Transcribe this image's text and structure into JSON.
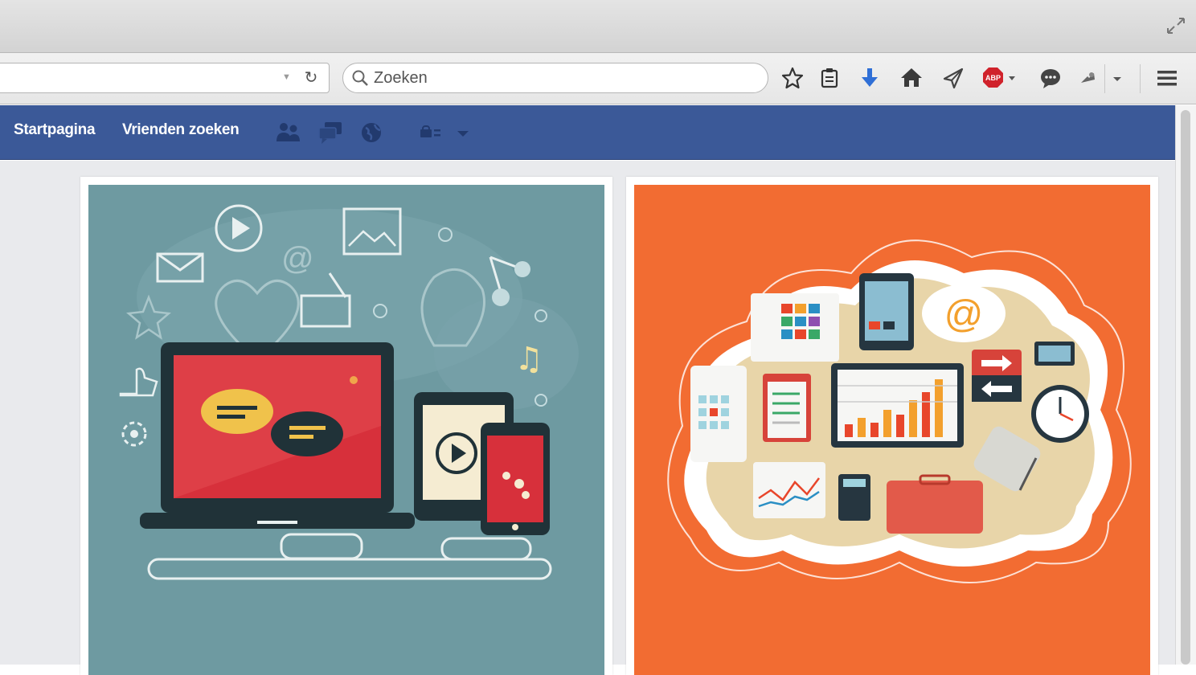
{
  "browser": {
    "search": {
      "placeholder": "Zoeken"
    },
    "toolbar_icons": [
      "star-icon",
      "clipboard-icon",
      "download-arrow-icon",
      "home-icon",
      "send-icon",
      "adblock-plus-icon",
      "chat-bubble-icon",
      "addon-icon",
      "menu-icon"
    ],
    "adblock_label": "ABP"
  },
  "facebook": {
    "brand_color": "#3b5998",
    "nav": {
      "home": "Startpagina",
      "find_friends": "Vrienden zoeken"
    },
    "icons": [
      "friend-requests-icon",
      "messages-icon",
      "notifications-globe-icon",
      "privacy-shortcuts-icon",
      "account-dropdown-icon"
    ]
  },
  "cards": [
    {
      "name": "devices-illustration",
      "background": "#6e9aa1"
    },
    {
      "name": "cloud-office-illustration",
      "background": "#f26c32"
    }
  ]
}
